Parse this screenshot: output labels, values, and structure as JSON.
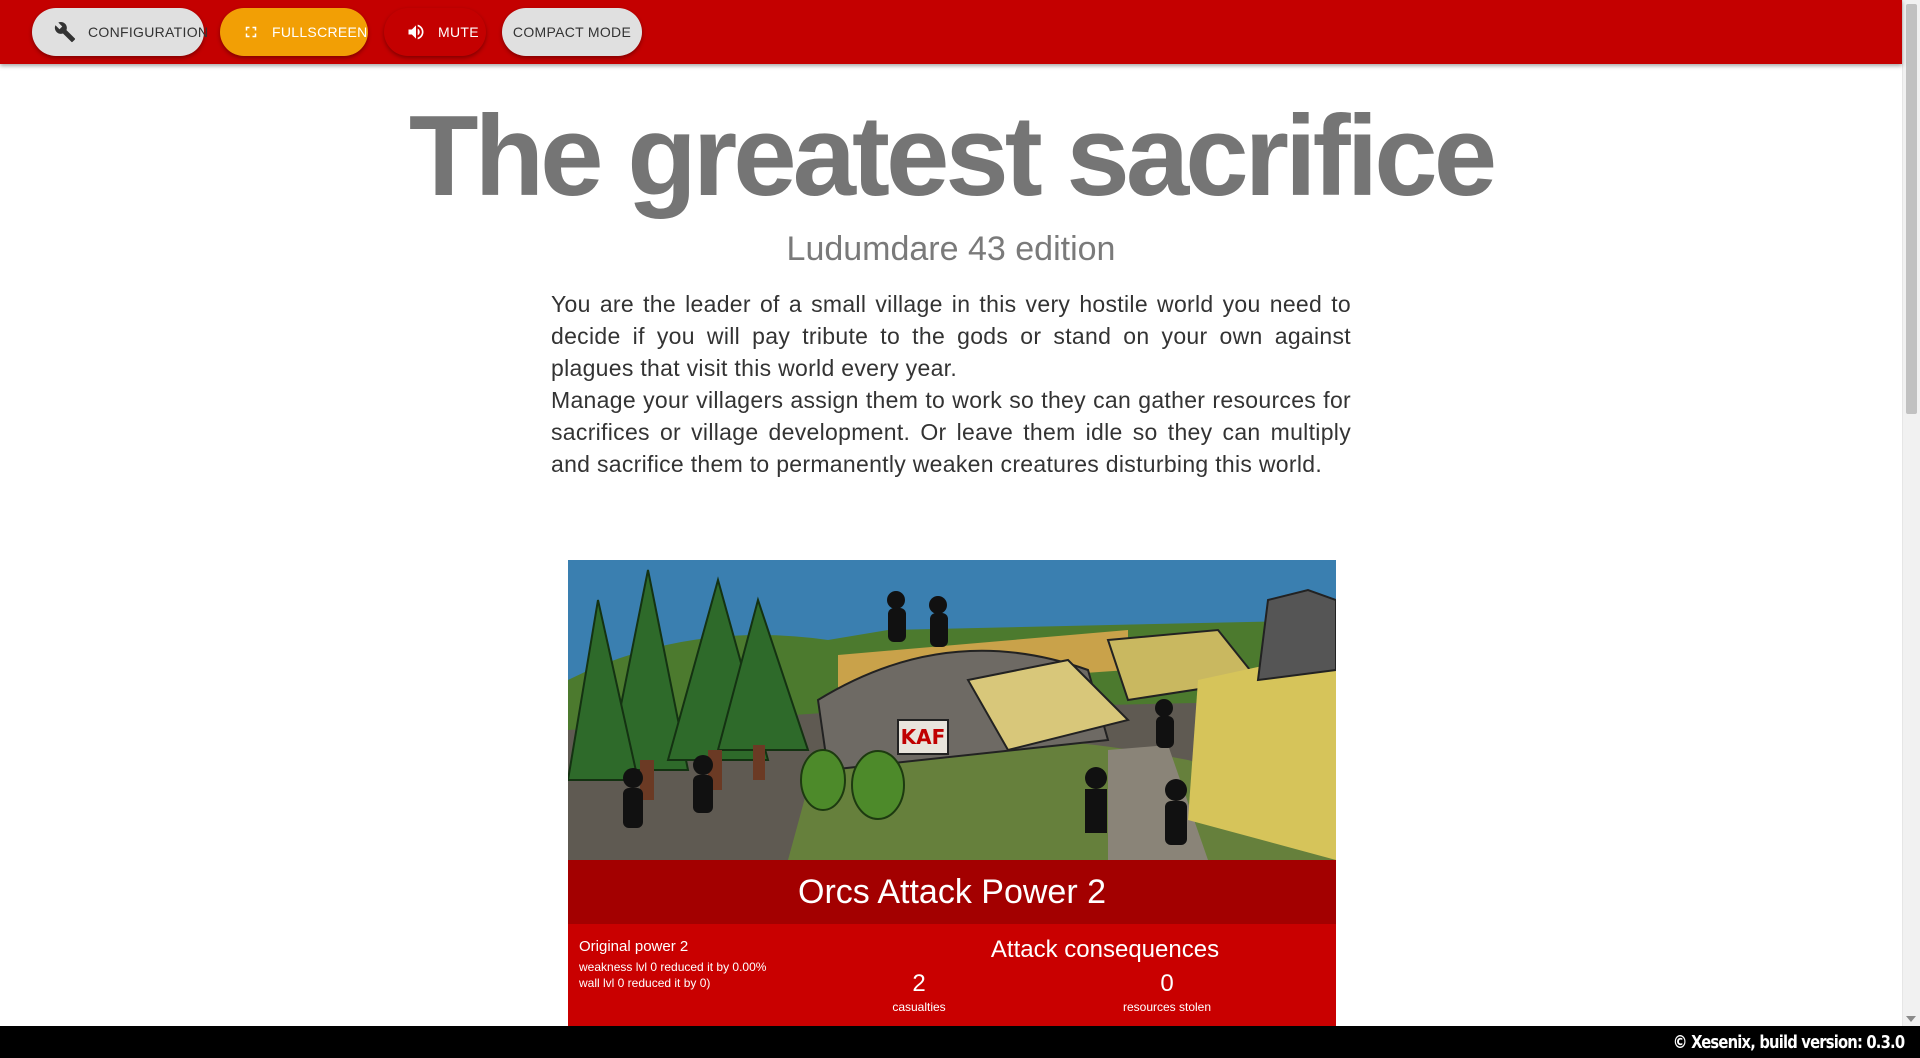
{
  "toolbar": {
    "configuration_label": "CONFIGURATION",
    "fullscreen_label": "FULLSCREEN",
    "mute_label": "MUTE",
    "compact_label": "COMPACT MODE"
  },
  "header": {
    "title": "The greatest sacrifice",
    "subtitle": "Ludumdare 43 edition"
  },
  "intro": {
    "paragraph_1": "You are the leader of a small village in this very hostile world you need to decide if you will pay tribute to the gods or stand on your own against plagues that visit this world every year.",
    "paragraph_2": "Manage your villagers assign them to work so they can gather resources for sacrifices or village development. Or leave them idle so they can multiply and sacrifice them to permanently weaken creatures disturbing this world."
  },
  "event": {
    "title": "Orcs Attack Power 2",
    "original_power": "Original power 2",
    "weakness_line": "weakness lvl 0 reduced it by 0.00%",
    "wall_line": "wall lvl 0 reduced it by 0)",
    "consequences_title": "Attack consequences",
    "casualties_value": "2",
    "casualties_label": "casualties",
    "resources_value": "0",
    "resources_label": "resources stolen",
    "sign_text": "KAF"
  },
  "footer": {
    "credit": "© Xesenix, build version: 0.3.0"
  },
  "colors": {
    "toolbar": "#c40000",
    "fullscreen": "#f29f05",
    "card_title": "#a30000",
    "card_body": "#c90000"
  }
}
